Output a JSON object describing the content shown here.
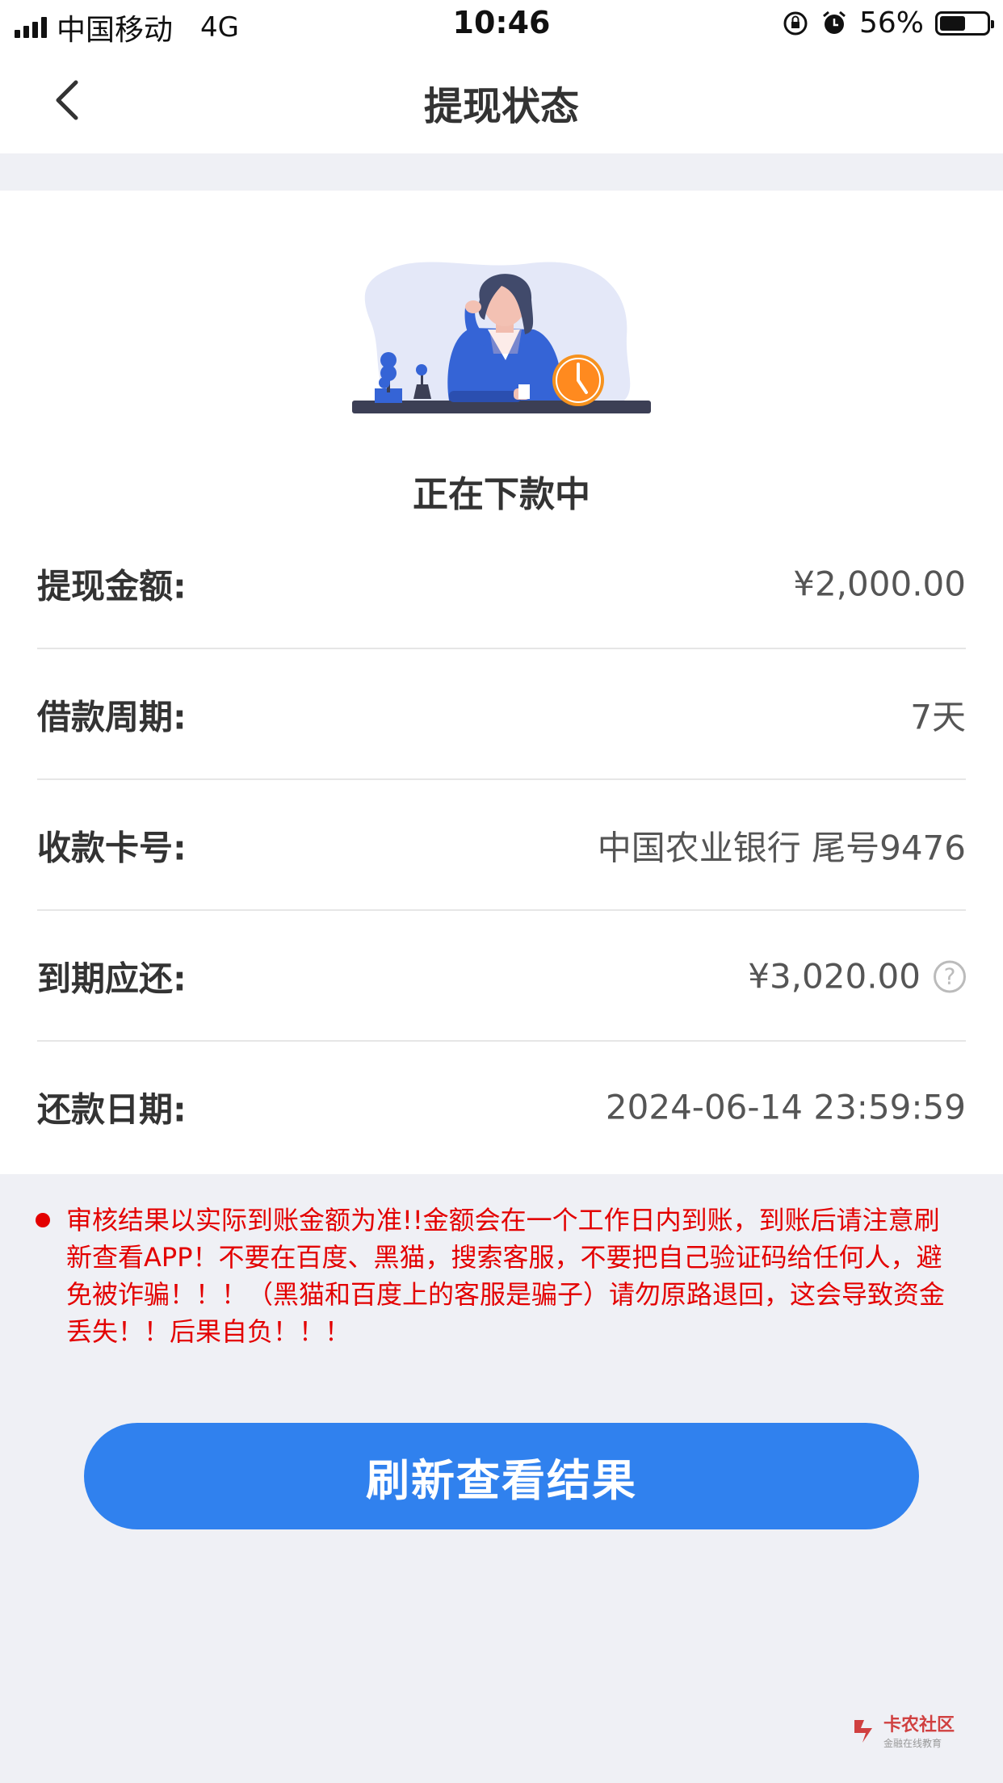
{
  "status_bar": {
    "carrier": "中国移动",
    "network": "4G",
    "time": "10:46",
    "battery_percent": "56%",
    "battery_level": 0.56
  },
  "nav": {
    "title": "提现状态"
  },
  "status": {
    "text": "正在下款中"
  },
  "details": [
    {
      "label": "提现金额:",
      "value": "¥2,000.00"
    },
    {
      "label": "借款周期:",
      "value": "7天"
    },
    {
      "label": "收款卡号:",
      "value": "中国农业银行 尾号9476"
    },
    {
      "label": "到期应还:",
      "value": "¥3,020.00"
    },
    {
      "label": "还款日期:",
      "value": "2024-06-14 23:59:59"
    }
  ],
  "help_glyph": "?",
  "notice": {
    "text": "审核结果以实际到账金额为准!!金额会在一个工作日内到账，到账后请注意刷新查看APP！不要在百度、黑猫，搜索客服，不要把自己验证码给任何人，避免被诈骗！！！（黑猫和百度上的客服是骗子）请勿原路退回，这会导致资金丢失！！后果自负！！！",
    "color": "#e30000"
  },
  "refresh_button": {
    "label": "刷新查看结果",
    "color": "#3081ee"
  },
  "watermark": {
    "title": "卡农社区",
    "subtitle": "金融在线教育"
  }
}
